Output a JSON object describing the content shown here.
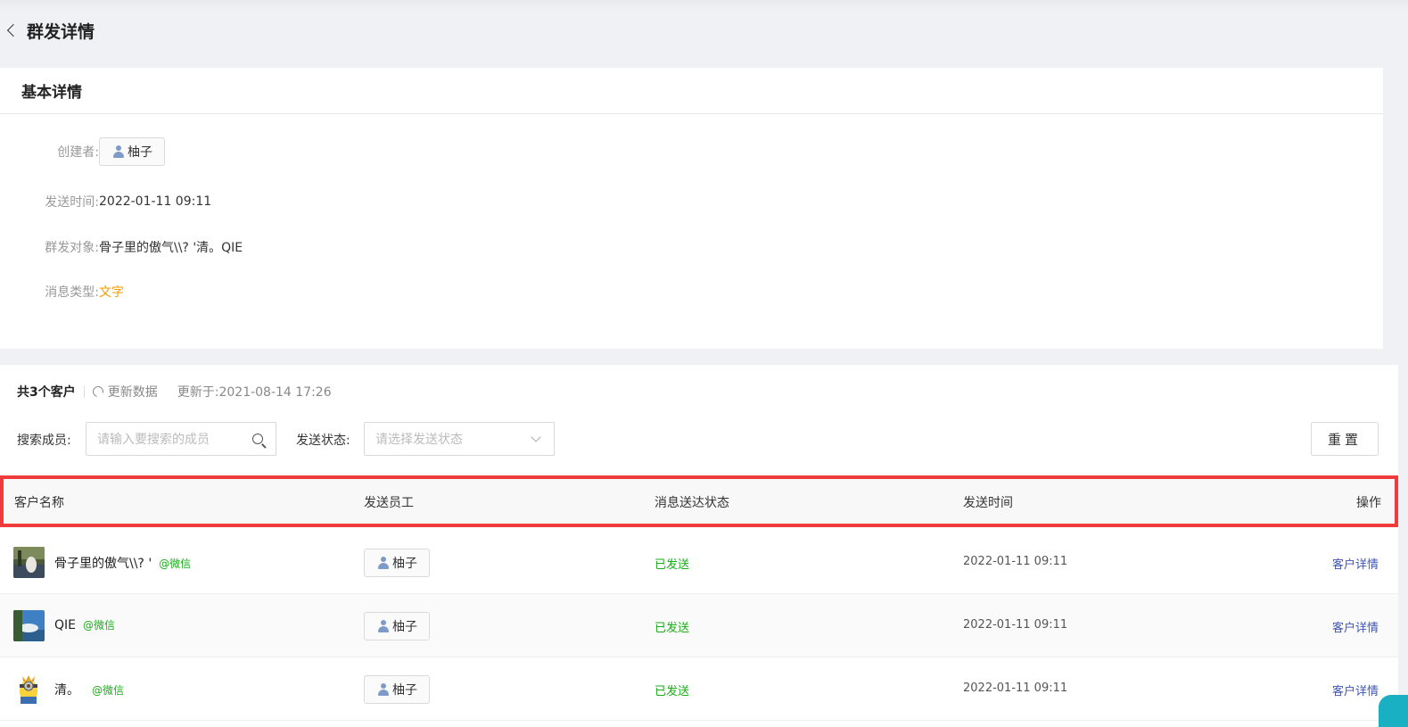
{
  "header": {
    "title": "群发详情"
  },
  "basic": {
    "section_title": "基本详情",
    "creator_label": "创建者:",
    "creator_name": "柚子",
    "send_time_label": "发送时间:",
    "send_time": "2022-01-11 09:11",
    "targets_label": "群发对象:",
    "targets": "骨子里的傲气\\\\? '清。QIE",
    "msg_type_label": "消息类型:",
    "msg_type": "文字",
    "msg_type_color": "#ff9900"
  },
  "list": {
    "count_text": "共3个客户",
    "refresh_label": "更新数据",
    "updated_text": "更新于:2021-08-14 17:26",
    "search_label": "搜索成员:",
    "search_placeholder": "请输入要搜索的成员",
    "status_label": "发送状态:",
    "status_placeholder": "请选择发送状态",
    "reset_label": "重置",
    "columns": [
      "客户名称",
      "发送员工",
      "消息送达状态",
      "发送时间",
      "操作"
    ],
    "rows": [
      {
        "name": "骨子里的傲气\\\\? '",
        "source": "@微信",
        "staff": "柚子",
        "status": "已发送",
        "time": "2022-01-11 09:11",
        "action": "客户详情",
        "avatar": "lake-photo"
      },
      {
        "name": "QIE",
        "source": "@微信",
        "staff": "柚子",
        "status": "已发送",
        "time": "2022-01-11 09:11",
        "action": "客户详情",
        "avatar": "sky-photo"
      },
      {
        "name": "清。",
        "source": "@微信",
        "staff": "柚子",
        "status": "已发送",
        "time": "2022-01-11 09:11",
        "action": "客户详情",
        "avatar": "minion-cartoon"
      }
    ]
  },
  "colors": {
    "sent_status": "#1aad19",
    "link": "#3d55b5",
    "highlight_border": "#ef3b3b"
  }
}
